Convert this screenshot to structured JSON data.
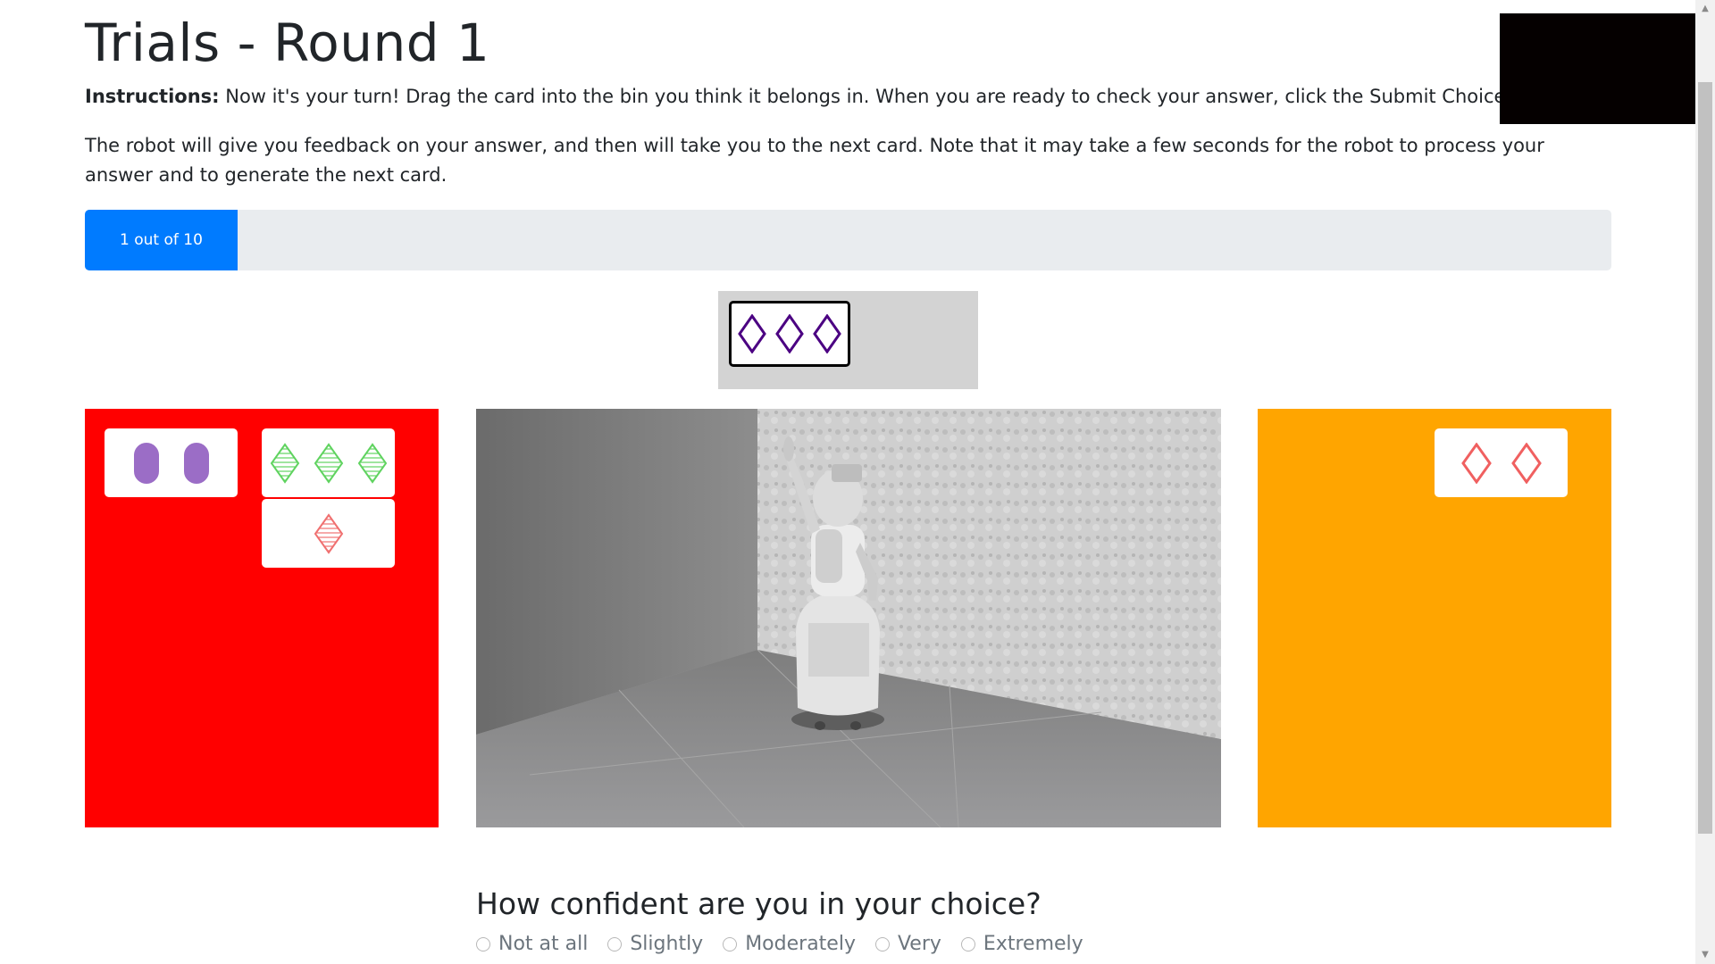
{
  "page": {
    "title": "Trials - Round 1",
    "instructions_label": "Instructions:",
    "instructions_text": " Now it's your turn! Drag the card into the bin you think it belongs in. When you are ready to check your answer, click the Submit Choice button.",
    "feedback_text": "The robot will give you feedback on your answer, and then will take you to the next card. Note that it may take a few seconds for the robot to process your answer and to generate the next card."
  },
  "progress": {
    "label": "1 out of 10",
    "fraction": 0.1,
    "color": "#007bff"
  },
  "current_card": {
    "shape": "diamond",
    "count": 3,
    "color": "#4b0082",
    "fill": "outline"
  },
  "bins": {
    "left": {
      "color": "#ff0000",
      "cards": [
        {
          "shape": "oval",
          "count": 2,
          "color": "#9b6dc6",
          "fill": "solid"
        },
        {
          "shape": "diamond",
          "count": 3,
          "color": "#5fd35f",
          "fill": "striped"
        },
        {
          "shape": "diamond",
          "count": 1,
          "color": "#f07070",
          "fill": "striped"
        }
      ]
    },
    "right": {
      "color": "#ffa500",
      "cards": [
        {
          "shape": "diamond",
          "count": 2,
          "color": "#f06060",
          "fill": "outline"
        }
      ]
    }
  },
  "robot_view": {
    "scene": "robot-simulation"
  },
  "confidence": {
    "question": "How confident are you in your choice?",
    "options": [
      "Not at all",
      "Slightly",
      "Moderately",
      "Very",
      "Extremely"
    ]
  }
}
